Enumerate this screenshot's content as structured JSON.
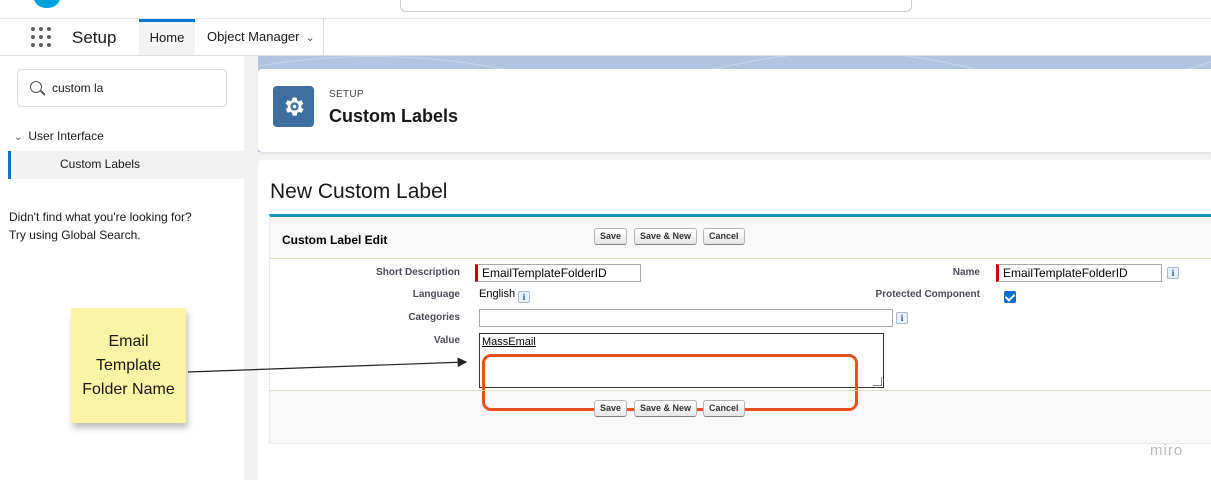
{
  "nav": {
    "app_name": "Setup",
    "tabs": [
      {
        "label": "Home"
      },
      {
        "label": "Object Manager"
      }
    ]
  },
  "sidebar": {
    "quick_find_value": "custom la",
    "tree_node": "User Interface",
    "tree_leaf": "Custom Labels",
    "not_found_line1": "Didn't find what you're looking for?",
    "not_found_line2": "Try using Global Search."
  },
  "header": {
    "eyebrow": "SETUP",
    "title": "Custom Labels"
  },
  "page": {
    "title": "New Custom Label"
  },
  "form": {
    "section_title": "Custom Label Edit",
    "buttons": {
      "save": "Save",
      "save_new": "Save & New",
      "cancel": "Cancel"
    },
    "fields": {
      "short_description_label": "Short Description",
      "short_description_value": "EmailTemplateFolderID",
      "language_label": "Language",
      "language_value": "English",
      "categories_label": "Categories",
      "categories_value": "",
      "value_label": "Value",
      "value_value": "MassEmail",
      "name_label": "Name",
      "name_value": "EmailTemplateFolderID",
      "protected_label": "Protected Component",
      "protected_checked": true
    },
    "info_glyph": "i"
  },
  "annotation": {
    "sticky_text": "Email Template Folder Name",
    "highlight_color": "#e8501f"
  },
  "watermark": "miro",
  "colors": {
    "brand_blue": "#0176d3",
    "header_icon": "#3e6e9d",
    "section_border": "#1797c0",
    "required": "#cc0000",
    "sticky": "#fbf3a5"
  }
}
